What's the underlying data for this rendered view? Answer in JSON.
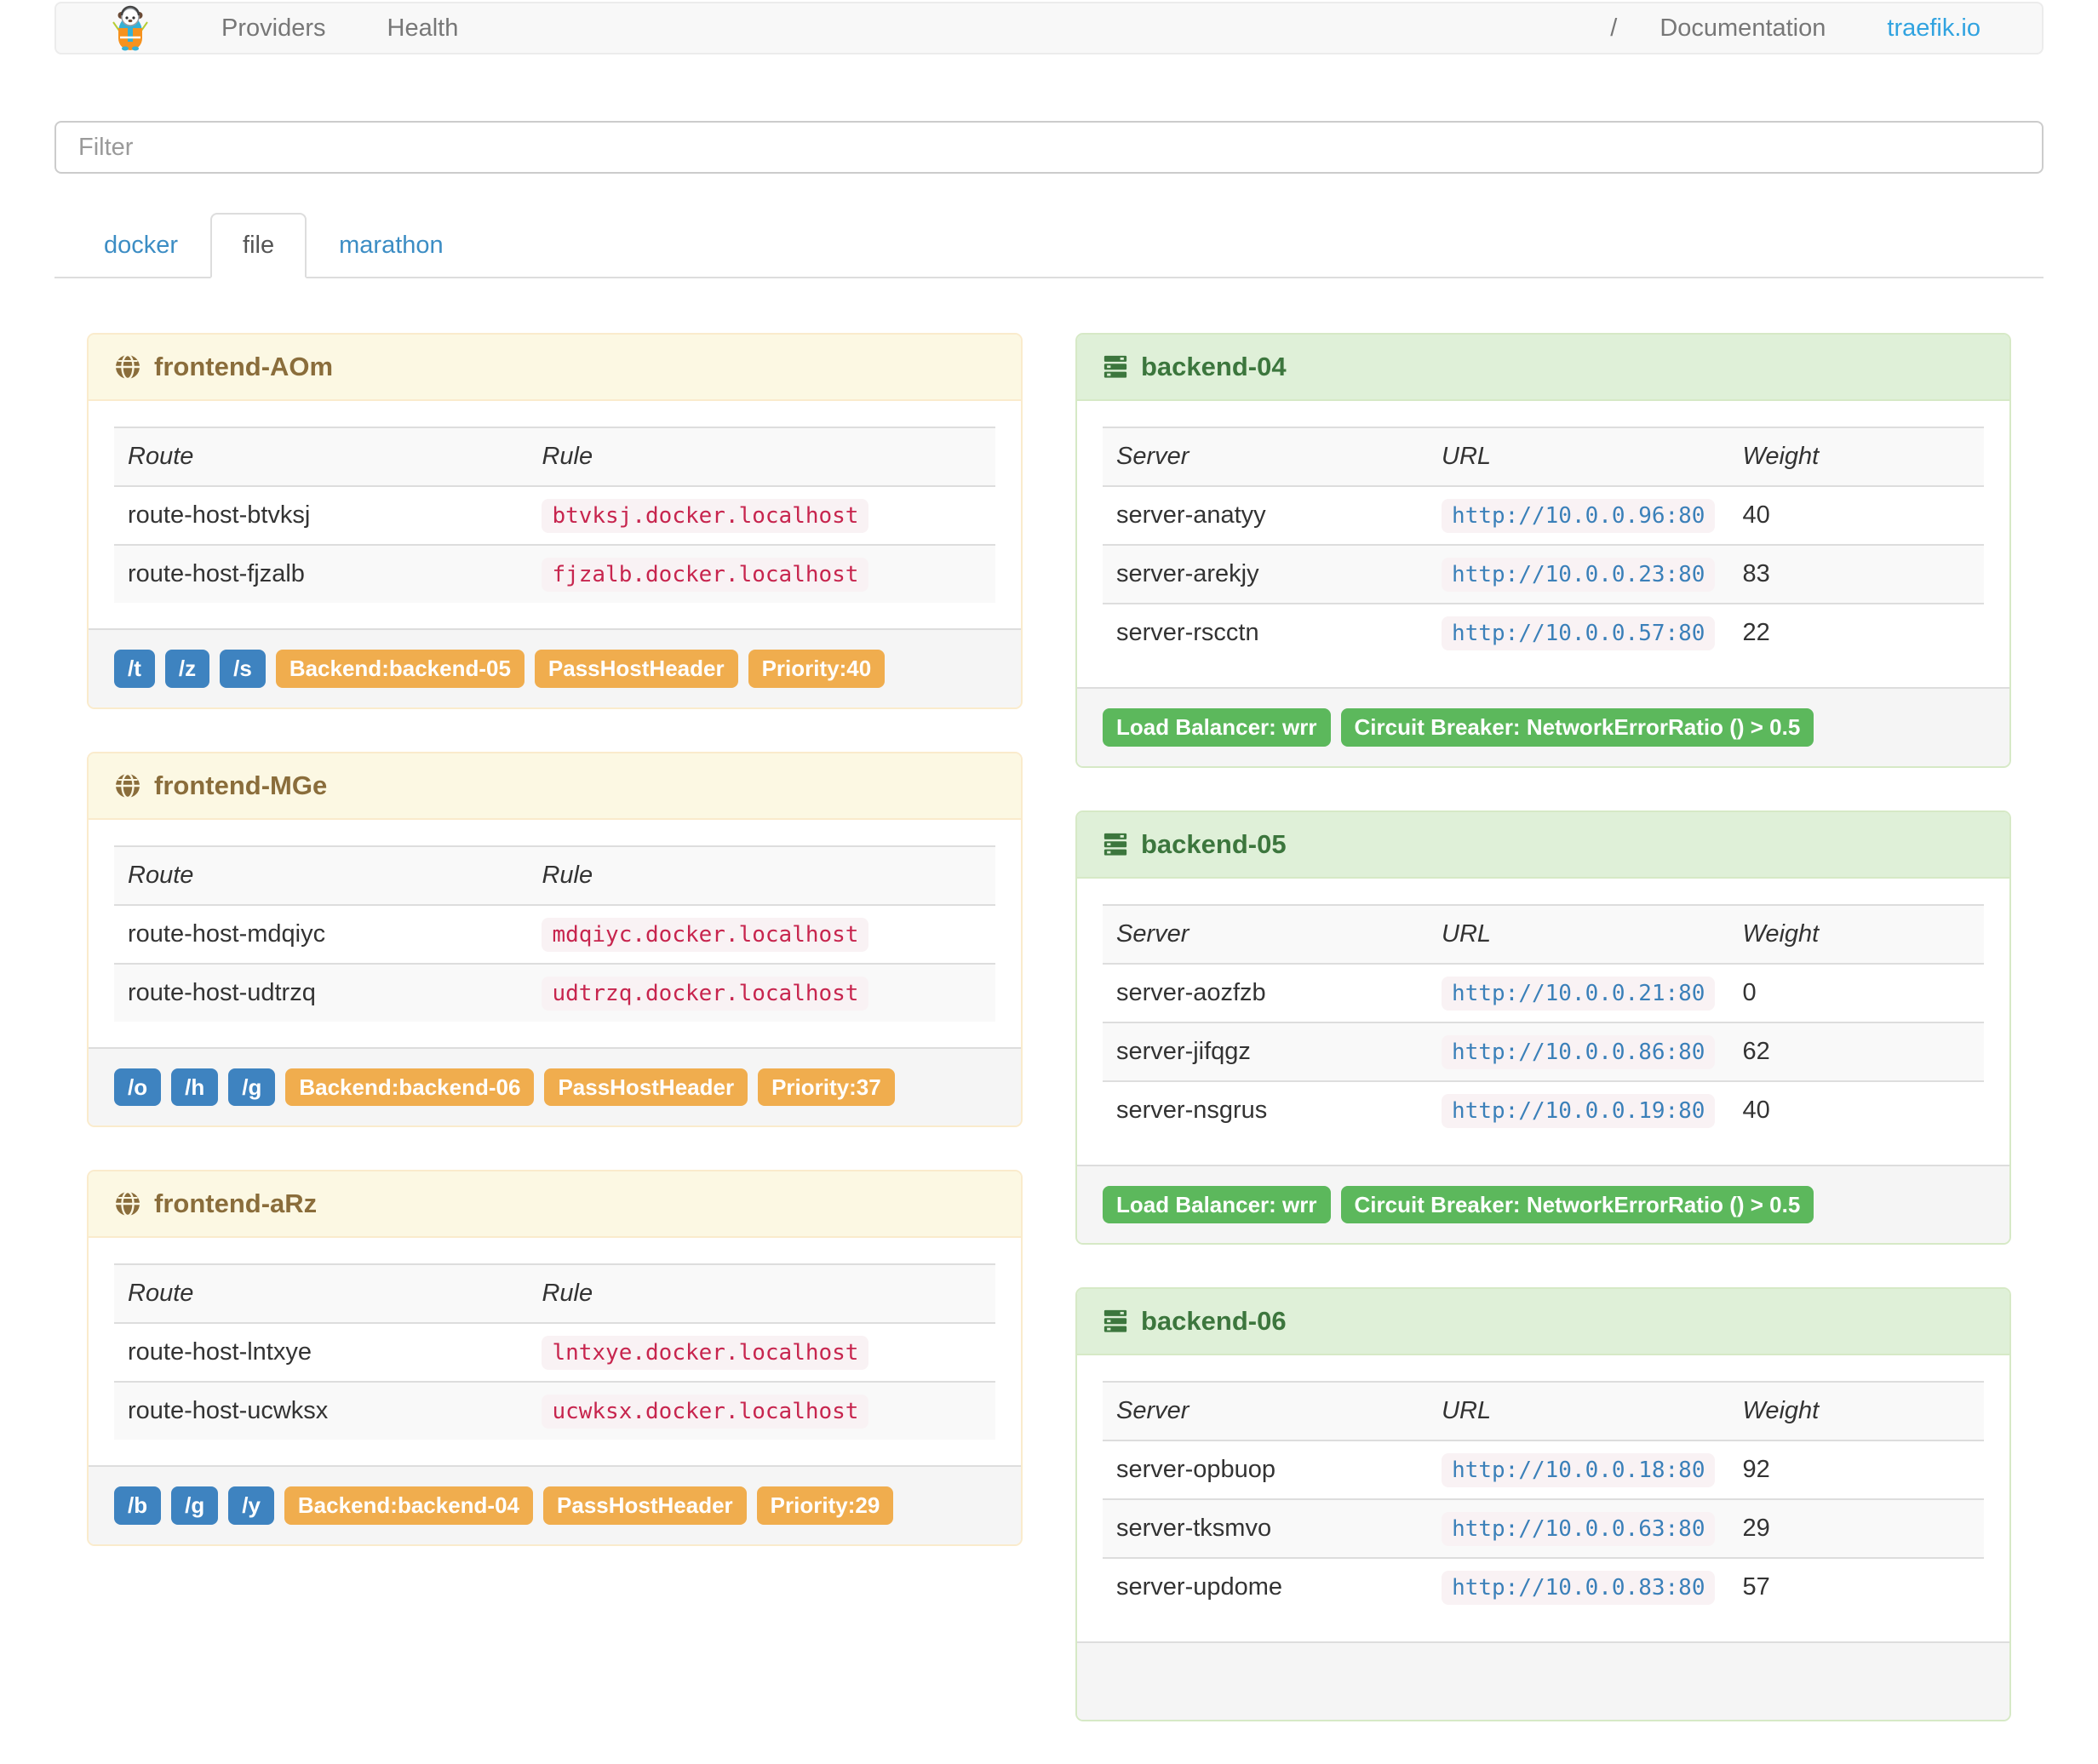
{
  "nav": {
    "providers": "Providers",
    "health": "Health",
    "slash": "/",
    "documentation": "Documentation",
    "site": "traefik.io"
  },
  "filter": {
    "placeholder": "Filter"
  },
  "tabs": [
    {
      "label": "docker",
      "active": false
    },
    {
      "label": "file",
      "active": true
    },
    {
      "label": "marathon",
      "active": false
    }
  ],
  "icons": {
    "brand": "traefik-logo",
    "frontend": "globe-icon",
    "backend": "server-stack-icon"
  },
  "colors": {
    "frontend_header_bg": "#fcf8e3",
    "frontend_header_text": "#8a6d3b",
    "frontend_border": "#faebcc",
    "backend_header_bg": "#dff0d8",
    "backend_header_text": "#3c763d",
    "backend_border": "#d6e9c6",
    "footer_bg": "#f5f5f5",
    "tag_blue": "#3e83c0",
    "tag_orange": "#f0ad4e",
    "tag_green": "#5cb85c",
    "rule_code_text": "#c7254e",
    "url_code_text": "#3b80b9",
    "code_bg": "#f9f2f4",
    "link_blue": "#31a3e0"
  },
  "frontend_columns": [
    "Route",
    "Rule"
  ],
  "backend_columns": [
    "Server",
    "URL",
    "Weight"
  ],
  "frontends": [
    {
      "name": "frontend-AOm",
      "routes": [
        {
          "route": "route-host-btvksj",
          "rule": "btvksj.docker.localhost"
        },
        {
          "route": "route-host-fjzalb",
          "rule": "fjzalb.docker.localhost"
        }
      ],
      "path_tags": [
        "/t",
        "/z",
        "/s"
      ],
      "badges": [
        "Backend:backend-05",
        "PassHostHeader",
        "Priority:40"
      ]
    },
    {
      "name": "frontend-MGe",
      "routes": [
        {
          "route": "route-host-mdqiyc",
          "rule": "mdqiyc.docker.localhost"
        },
        {
          "route": "route-host-udtrzq",
          "rule": "udtrzq.docker.localhost"
        }
      ],
      "path_tags": [
        "/o",
        "/h",
        "/g"
      ],
      "badges": [
        "Backend:backend-06",
        "PassHostHeader",
        "Priority:37"
      ]
    },
    {
      "name": "frontend-aRz",
      "routes": [
        {
          "route": "route-host-lntxye",
          "rule": "lntxye.docker.localhost"
        },
        {
          "route": "route-host-ucwksx",
          "rule": "ucwksx.docker.localhost"
        }
      ],
      "path_tags": [
        "/b",
        "/g",
        "/y"
      ],
      "badges": [
        "Backend:backend-04",
        "PassHostHeader",
        "Priority:29"
      ]
    }
  ],
  "backends": [
    {
      "name": "backend-04",
      "servers": [
        {
          "server": "server-anatyy",
          "url": "http://10.0.0.96:80",
          "weight": "40"
        },
        {
          "server": "server-arekjy",
          "url": "http://10.0.0.23:80",
          "weight": "83"
        },
        {
          "server": "server-rscctn",
          "url": "http://10.0.0.57:80",
          "weight": "22"
        }
      ],
      "badges": [
        "Load Balancer: wrr",
        "Circuit Breaker: NetworkErrorRatio () > 0.5"
      ]
    },
    {
      "name": "backend-05",
      "servers": [
        {
          "server": "server-aozfzb",
          "url": "http://10.0.0.21:80",
          "weight": "0"
        },
        {
          "server": "server-jifqgz",
          "url": "http://10.0.0.86:80",
          "weight": "62"
        },
        {
          "server": "server-nsgrus",
          "url": "http://10.0.0.19:80",
          "weight": "40"
        }
      ],
      "badges": [
        "Load Balancer: wrr",
        "Circuit Breaker: NetworkErrorRatio () > 0.5"
      ]
    },
    {
      "name": "backend-06",
      "servers": [
        {
          "server": "server-opbuop",
          "url": "http://10.0.0.18:80",
          "weight": "92"
        },
        {
          "server": "server-tksmvo",
          "url": "http://10.0.0.63:80",
          "weight": "29"
        },
        {
          "server": "server-updome",
          "url": "http://10.0.0.83:80",
          "weight": "57"
        }
      ],
      "badges": []
    }
  ]
}
